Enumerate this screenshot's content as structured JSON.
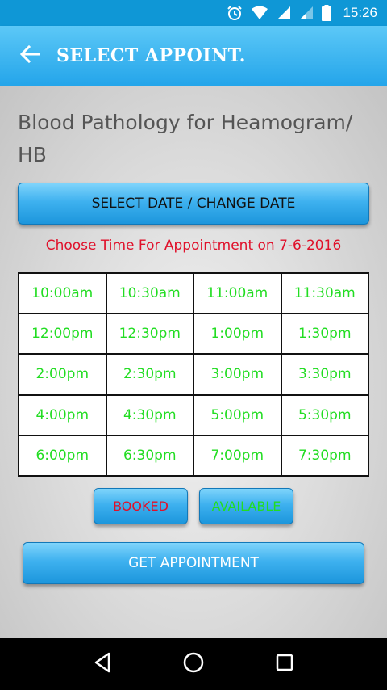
{
  "status_bar": {
    "time": "15:26",
    "icons": [
      "alarm-icon",
      "wifi-icon",
      "signal-icon",
      "signal-weak-icon",
      "battery-icon"
    ]
  },
  "app_bar": {
    "title": "SELECT APPOINT.",
    "back_icon": "arrow-left-icon"
  },
  "test": {
    "name": "Blood Pathology for Heamogram/ HB"
  },
  "date_button": {
    "label": "SELECT DATE / CHANGE DATE"
  },
  "appointment": {
    "choose_label": "Choose Time For Appointment on 7-6-2016",
    "slots": [
      "10:00am",
      "10:30am",
      "11:00am",
      "11:30am",
      "12:00pm",
      "12:30pm",
      "1:00pm",
      "1:30pm",
      "2:00pm",
      "2:30pm",
      "3:00pm",
      "3:30pm",
      "4:00pm",
      "4:30pm",
      "5:00pm",
      "5:30pm",
      "6:00pm",
      "6:30pm",
      "7:00pm",
      "7:30pm"
    ]
  },
  "legend": {
    "booked": "BOOKED",
    "available": "AVAILABLE"
  },
  "get_appointment": {
    "label": "GET APPOINTMENT"
  },
  "colors": {
    "app_bar": "#24a5ea",
    "status_bar": "#0f97d6",
    "available": "#22dd22",
    "booked": "#e0102a"
  },
  "nav_bar": {
    "icons": [
      "back-triangle-icon",
      "home-circle-icon",
      "recents-square-icon"
    ]
  }
}
